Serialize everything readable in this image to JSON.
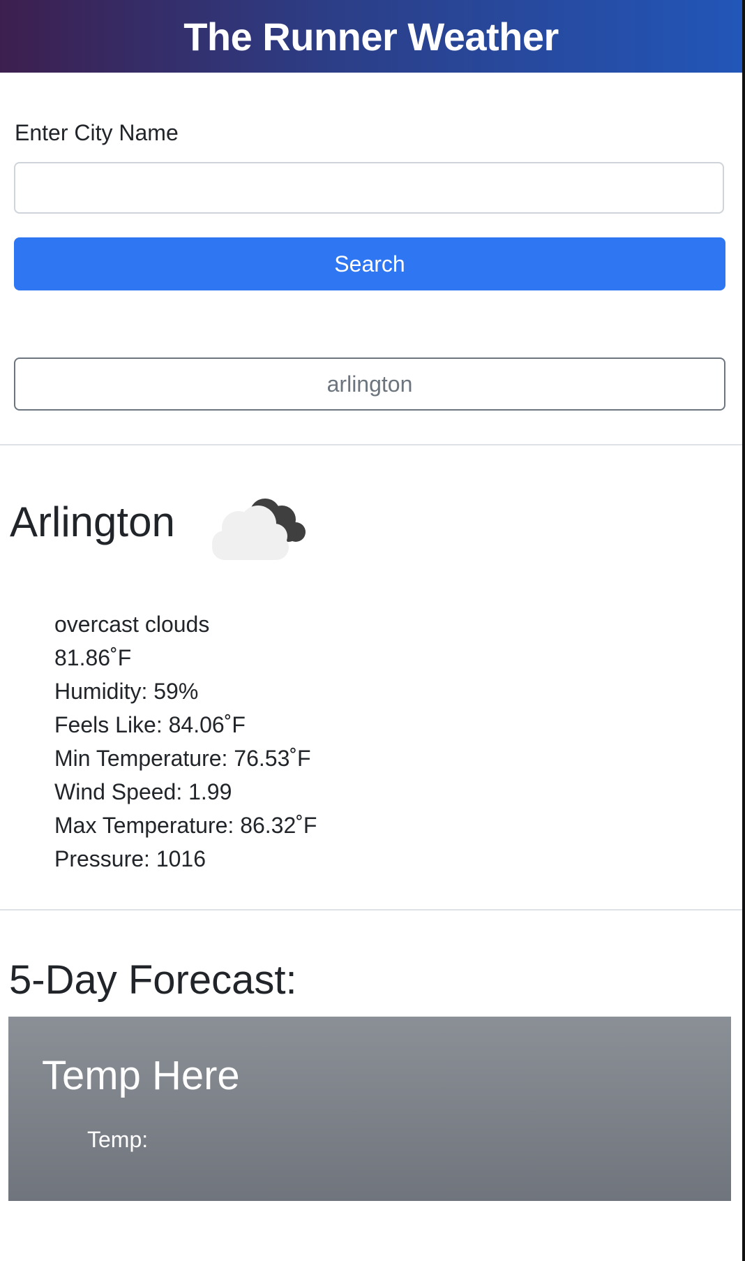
{
  "header": {
    "title": "The Runner Weather",
    "accent_start": "#3d1f4f",
    "accent_end": "#2256b8"
  },
  "search": {
    "label": "Enter City Name",
    "value": "",
    "placeholder": "",
    "button_label": "Search",
    "button_color": "#2f76f2"
  },
  "history": {
    "items": [
      {
        "label": "arlington"
      }
    ]
  },
  "current": {
    "city": "Arlington",
    "icon": "overcast-clouds-icon",
    "details": [
      "overcast clouds",
      "81.86˚F",
      "Humidity: 59%",
      "Feels Like: 84.06˚F",
      "Min Temperature: 76.53˚F",
      "Wind Speed: 1.99",
      "Max Temperature: 86.32˚F",
      "Pressure: 1016"
    ]
  },
  "forecast": {
    "title": "5-Day Forecast:",
    "cards": [
      {
        "title": "Temp Here",
        "temp_label": "Temp:"
      }
    ]
  }
}
